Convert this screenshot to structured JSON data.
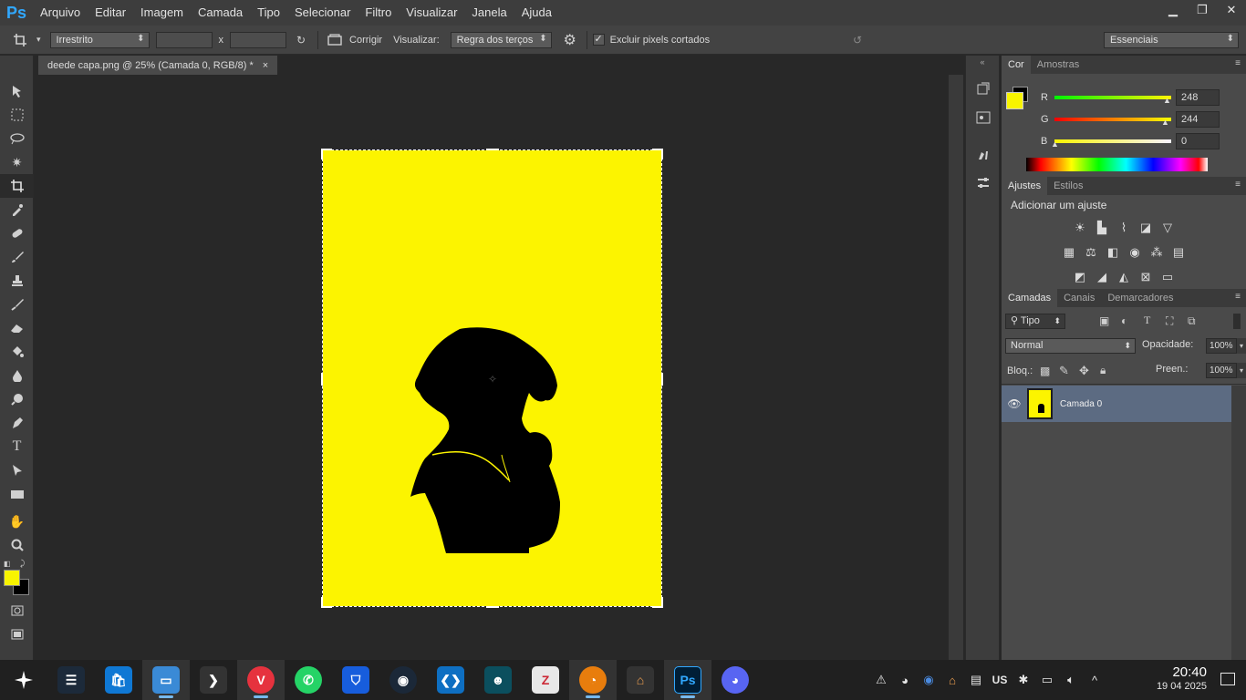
{
  "app": {
    "logo": "Ps"
  },
  "menu": [
    "Arquivo",
    "Editar",
    "Imagem",
    "Camada",
    "Tipo",
    "Selecionar",
    "Filtro",
    "Visualizar",
    "Janela",
    "Ajuda"
  ],
  "options": {
    "ratio": "Irrestrito",
    "x_sep": "x",
    "straighten": "Corrigir",
    "view_label": "Visualizar:",
    "view_value": "Regra dos terços",
    "delete_cropped": "Excluir pixels cortados",
    "delete_cropped_checked": true,
    "workspace": "Essenciais"
  },
  "document": {
    "tab": "deede capa.png @ 25% (Camada 0, RGB/8) *",
    "close": "×",
    "background": "#fcf400"
  },
  "color_panel": {
    "tabs": [
      "Cor",
      "Amostras"
    ],
    "foreground": "#f8f400",
    "background": "#000000",
    "r_label": "R",
    "r": "248",
    "g_label": "G",
    "g": "244",
    "b_label": "B",
    "b": "0"
  },
  "adjustments_panel": {
    "tabs": [
      "Ajustes",
      "Estilos"
    ],
    "title": "Adicionar um ajuste"
  },
  "layers_panel": {
    "tabs": [
      "Camadas",
      "Canais",
      "Demarcadores"
    ],
    "filter": "Tipo",
    "blend_mode": "Normal",
    "opacity_label": "Opacidade:",
    "opacity": "100%",
    "lock_label": "Bloq.:",
    "fill_label": "Preen.:",
    "fill": "100%",
    "layer_name": "Camada 0"
  },
  "taskbar": {
    "lang": "US",
    "time": "20:40",
    "date": "19 04 2025"
  },
  "colors": {
    "accent": "#31a8ff",
    "layer_selected": "#5c6b82",
    "canvas_yellow": "#fcf400"
  }
}
